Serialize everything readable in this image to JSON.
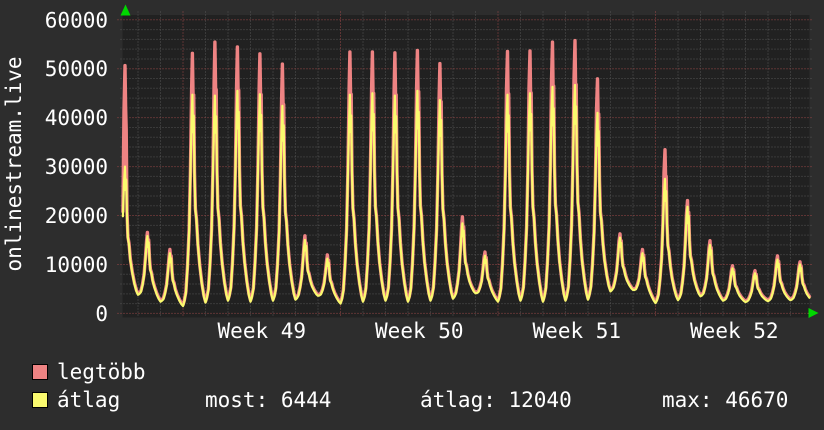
{
  "chart_data": {
    "type": "line",
    "title": "onlinestream.live",
    "y_axis_title": "onlinestream.live",
    "ylim": [
      0,
      60000
    ],
    "y_tick_step": 10000,
    "y_minor_step": 2000,
    "y_tick_labels": [
      "0",
      "10000",
      "20000",
      "30000",
      "40000",
      "50000",
      "60000"
    ],
    "x_tick_labels": [
      "Week 49",
      "Week 50",
      "Week 51",
      "Week 52"
    ],
    "grid": {
      "horizontal_major": true,
      "horizontal_minor": true,
      "vertical_daily": true,
      "vertical_weekly_red": true,
      "style": "dotted"
    },
    "legend_position": "bottom-left",
    "colors": {
      "background": "#2d2d2d",
      "plot_background": "#212121",
      "grid_minor": "#535353",
      "grid_major": "#9a4747",
      "text": "#ffffff",
      "arrow": "#00d800",
      "series_max": "#ee8383",
      "series_avg": "#fafa6e"
    },
    "series": [
      {
        "name": "legtöbb",
        "role": "max",
        "color": "#ee8383"
      },
      {
        "name": "átlag",
        "role": "avg",
        "color": "#fafa6e"
      }
    ],
    "days": [
      {
        "max": 50400,
        "avg": 30000,
        "valley": 3000
      },
      {
        "max": 16300,
        "avg": 15800,
        "valley": 3800
      },
      {
        "max": 12800,
        "avg": 12300,
        "valley": 2400
      },
      {
        "max": 52900,
        "avg": 44700,
        "valley": 1500
      },
      {
        "max": 55200,
        "avg": 44500,
        "valley": 2200
      },
      {
        "max": 54200,
        "avg": 45500,
        "valley": 2600
      },
      {
        "max": 52800,
        "avg": 44800,
        "valley": 2400
      },
      {
        "max": 50700,
        "avg": 42400,
        "valley": 2600
      },
      {
        "max": 15600,
        "avg": 15000,
        "valley": 2800
      },
      {
        "max": 11700,
        "avg": 11200,
        "valley": 3600
      },
      {
        "max": 53200,
        "avg": 44700,
        "valley": 2000
      },
      {
        "max": 53200,
        "avg": 45000,
        "valley": 2400
      },
      {
        "max": 53000,
        "avg": 44500,
        "valley": 2600
      },
      {
        "max": 53500,
        "avg": 45500,
        "valley": 2400
      },
      {
        "max": 50800,
        "avg": 43600,
        "valley": 2600
      },
      {
        "max": 19500,
        "avg": 18400,
        "valley": 3000
      },
      {
        "max": 12300,
        "avg": 11800,
        "valley": 4100
      },
      {
        "max": 53300,
        "avg": 44700,
        "valley": 2400
      },
      {
        "max": 53400,
        "avg": 45000,
        "valley": 2600
      },
      {
        "max": 55200,
        "avg": 46300,
        "valley": 2400
      },
      {
        "max": 55500,
        "avg": 46670,
        "valley": 2600
      },
      {
        "max": 47700,
        "avg": 41000,
        "valley": 2800
      },
      {
        "max": 16000,
        "avg": 15500,
        "valley": 4500
      },
      {
        "max": 12800,
        "avg": 12300,
        "valley": 4800
      },
      {
        "max": 33200,
        "avg": 27500,
        "valley": 2100
      },
      {
        "max": 22800,
        "avg": 21800,
        "valley": 2700
      },
      {
        "max": 14600,
        "avg": 14000,
        "valley": 3500
      },
      {
        "max": 9500,
        "avg": 9200,
        "valley": 2600
      },
      {
        "max": 8500,
        "avg": 8200,
        "valley": 2300
      },
      {
        "max": 11500,
        "avg": 11000,
        "valley": 2500
      },
      {
        "max": 10300,
        "avg": 10000,
        "valley": 2700
      }
    ]
  },
  "legend": {
    "items": [
      {
        "label": "legtöbb",
        "color": "#ee8383"
      },
      {
        "label": "átlag",
        "color": "#fafa6e"
      }
    ]
  },
  "stats": {
    "most": "most: 6444",
    "avg": "átlag: 12040",
    "max": "max: 46670"
  }
}
